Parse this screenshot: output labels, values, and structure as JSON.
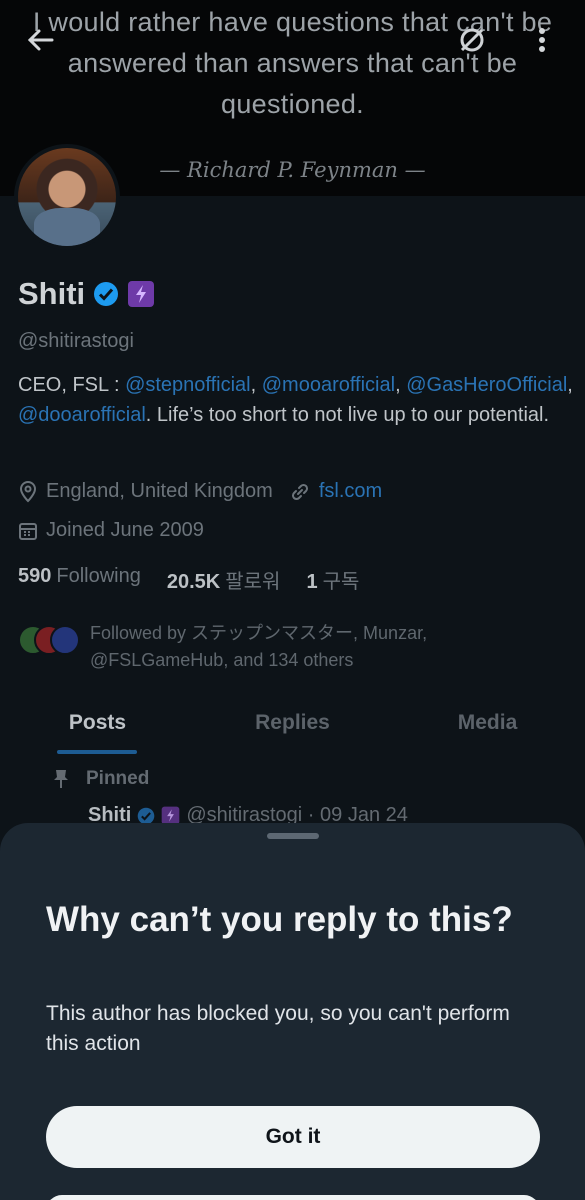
{
  "banner": {
    "quote": "I would rather have questions that can't be answered than answers that can't be questioned.",
    "attribution": "— Richard P. Feynman —"
  },
  "profile": {
    "name": "Shiti",
    "handle": "@shitirastogi",
    "bio_prefix": "CEO, FSL : ",
    "bio_links": [
      "@stepnofficial",
      "@mooarofficial",
      "@GasHeroOfficial",
      "@dooarofficial"
    ],
    "bio_suffix": ". Life’s too short to not live up to our potential.",
    "location": "England, United Kingdom",
    "website": "fsl.com",
    "joined": "Joined June 2009",
    "following_count": "590",
    "following_label": "Following",
    "followers_count": "20.5K",
    "followers_label": "팔로워",
    "subscriptions_count": "1",
    "subscriptions_label": "구독",
    "followed_by": "Followed by ステップンマスター, Munzar, @FSLGameHub, and 134 others"
  },
  "tabs": [
    "Posts",
    "Replies",
    "Media"
  ],
  "pinned": {
    "label": "Pinned",
    "name": "Shiti",
    "meta": "@shitirastogi · 09 Jan 24"
  },
  "sheet": {
    "title": "Why can’t you reply to this?",
    "message": "This author has blocked you, so you can't perform this action",
    "button": "Got it"
  },
  "colors": {
    "verified": "#1d9bf0",
    "link": "#2a73b4",
    "button_bg": "#eff3f4",
    "sheet_bg": "#1c2731"
  },
  "icons": [
    "back-arrow-icon",
    "grok-icon",
    "more-vertical-icon",
    "verified-badge-icon",
    "premium-badge-icon",
    "location-icon",
    "link-icon",
    "calendar-icon",
    "pin-icon"
  ]
}
